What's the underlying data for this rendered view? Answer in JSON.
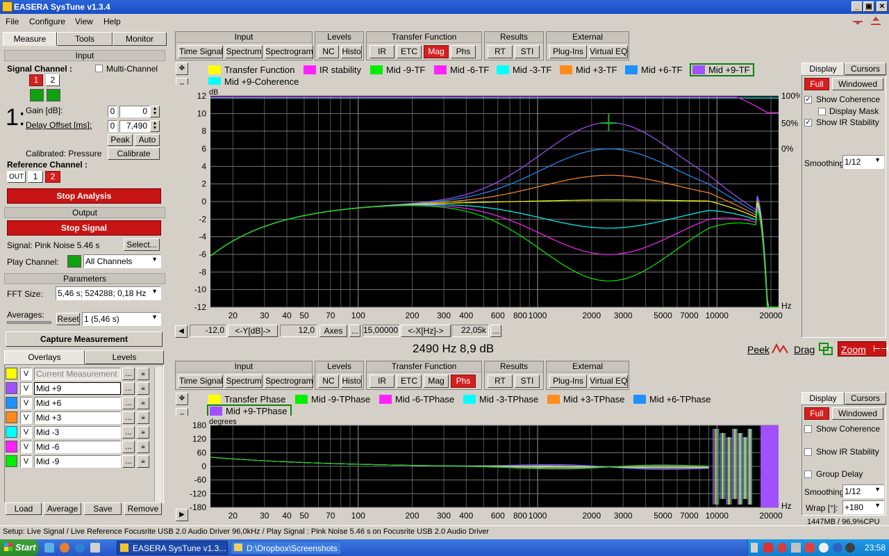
{
  "window": {
    "title": "EASERA SysTune v1.3.4",
    "min": "_",
    "max": "▣",
    "close": "✕"
  },
  "menu": [
    "File",
    "Configure",
    "View",
    "Help"
  ],
  "left": {
    "tabs": [
      "Measure",
      "Tools",
      "Monitor"
    ],
    "input": {
      "header": "Input",
      "signal_channel": "Signal Channel :",
      "multi_channel": "Multi-Channel",
      "ch1": "1",
      "ch2": "2",
      "big_index": "1:",
      "gain_label": "Gain [dB]:",
      "gain_check": "0",
      "gain_value": "0",
      "delay_label": "Delay Offset [ms]:",
      "delay_check": "0",
      "delay_value": "7,490",
      "peak": "Peak",
      "auto": "Auto",
      "calibrated": "Calibrated: Pressure",
      "calibrate": "Calibrate",
      "reference_channel": "Reference Channel :",
      "ref_out": "OUT",
      "ref_1": "1",
      "ref_2": "2"
    },
    "stop_analysis": "Stop Analysis",
    "output": {
      "header": "Output",
      "stop_signal": "Stop Signal",
      "signal_label": "Signal: Pink Noise  5.46 s",
      "select": "Select...",
      "play_channel": "Play Channel:",
      "play_value": "All Channels"
    },
    "parameters": {
      "header": "Parameters",
      "fft_label": "FFT Size:",
      "fft_value": "5,46 s; 524288; 0,18 Hz",
      "averages_label": "Averages:",
      "reset": "Reset",
      "avg_value": "1 (5,46 s)"
    },
    "capture": "Capture Measurement",
    "overlay_tabs": [
      "Overlays",
      "Levels"
    ],
    "overlays": [
      {
        "color": "#ffff00",
        "name": "Current Measurement",
        "v": "V"
      },
      {
        "color": "#a050ff",
        "name": "Mid +9",
        "v": "V"
      },
      {
        "color": "#1e90ff",
        "name": "Mid +6",
        "v": "V"
      },
      {
        "color": "#ff8c1a",
        "name": "Mid +3",
        "v": "V"
      },
      {
        "color": "#00ffff",
        "name": "Mid -3",
        "v": "V"
      },
      {
        "color": "#ff22ff",
        "name": "Mid -6",
        "v": "V"
      },
      {
        "color": "#00ee00",
        "name": "Mid -9",
        "v": "V"
      }
    ],
    "overlay_more": "...",
    "overlay_buttons": [
      "Load",
      "Average",
      "Save",
      "Remove"
    ]
  },
  "toolbar_groups": [
    {
      "title": "Input",
      "buttons": [
        "Time Signal",
        "Spectrum",
        "Spectrogram"
      ]
    },
    {
      "title": "Levels",
      "buttons": [
        "NC",
        "Histo"
      ]
    },
    {
      "title": "Transfer Function",
      "buttons": [
        "IR",
        "ETC",
        "Mag",
        "Phs"
      ]
    },
    {
      "title": "Results",
      "buttons": [
        "RT",
        "STI"
      ]
    },
    {
      "title": "External",
      "buttons": [
        "Plug-Ins",
        "Virtual EQ"
      ]
    }
  ],
  "top_plot": {
    "legend": [
      {
        "color": "#ffff00",
        "label": "Transfer Function"
      },
      {
        "color": "#ff22ff",
        "label": "IR stability"
      },
      {
        "color": "#00ee00",
        "label": "Mid -9-TF"
      },
      {
        "color": "#ff22ff",
        "label": "Mid -6-TF"
      },
      {
        "color": "#00ffff",
        "label": "Mid -3-TF"
      },
      {
        "color": "#ff8c1a",
        "label": "Mid +3-TF"
      },
      {
        "color": "#1e90ff",
        "label": "Mid +6-TF"
      },
      {
        "color": "#a050ff",
        "label": "Mid +9-TF"
      },
      {
        "color": "#00ffff",
        "label": "Mid +9-Coherence"
      }
    ],
    "y_unit": "dB",
    "x_unit": "Hz",
    "y_ticks": [
      "12",
      "10",
      "8",
      "6",
      "4",
      "2",
      "0",
      "-2",
      "-4",
      "-6",
      "-8",
      "-10",
      "-12"
    ],
    "right_ticks": [
      "100%",
      "50%",
      "0%"
    ],
    "x_ticks": [
      "20",
      "30",
      "40",
      "50",
      "70",
      "100",
      "200",
      "300",
      "400",
      "600",
      "800",
      "1000",
      "2000",
      "3000",
      "5000",
      "7000",
      "10000",
      "20000"
    ],
    "axis_bar": {
      "ymin": "-12,0",
      "ylab": "<-Y[dB]->",
      "ymax": "12,0",
      "axes": "Axes",
      "dots": "...",
      "xmin": "15,00000",
      "xlab": "<-X[Hz]->",
      "xmax": "22,05k"
    },
    "readout": "2490 Hz   8,9 dB",
    "peek": "Peek",
    "drag": "Drag",
    "zoom": "Zoom"
  },
  "top_side": {
    "tabs": [
      "Display",
      "Cursors"
    ],
    "full": "Full",
    "windowed": "Windowed",
    "show_coherence": "Show Coherence",
    "display_mask": "Display Mask",
    "show_ir_stability": "Show IR Stability",
    "smoothing_label": "Smoothing:",
    "smoothing_value": "1/12"
  },
  "bottom_plot": {
    "legend": [
      {
        "color": "#ffff00",
        "label": "Transfer Phase"
      },
      {
        "color": "#00ee00",
        "label": "Mid -9-TPhase"
      },
      {
        "color": "#ff22ff",
        "label": "Mid -6-TPhase"
      },
      {
        "color": "#00ffff",
        "label": "Mid -3-TPhase"
      },
      {
        "color": "#ff8c1a",
        "label": "Mid +3-TPhase"
      },
      {
        "color": "#1e90ff",
        "label": "Mid +6-TPhase"
      },
      {
        "color": "#a050ff",
        "label": "Mid +9-TPhase"
      }
    ],
    "y_unit": "degrees",
    "x_unit": "Hz",
    "y_ticks": [
      "180",
      "120",
      "60",
      "0",
      "-60",
      "-120",
      "-180"
    ],
    "x_ticks": [
      "20",
      "30",
      "40",
      "50",
      "70",
      "100",
      "200",
      "300",
      "400",
      "600",
      "800",
      "1000",
      "2000",
      "3000",
      "5000",
      "7000",
      "10000",
      "20000"
    ]
  },
  "bottom_side": {
    "tabs": [
      "Display",
      "Cursors"
    ],
    "full": "Full",
    "windowed": "Windowed",
    "show_coherence": "Show Coherence",
    "show_ir_stability": "Show IR Stability",
    "group_delay": "Group Delay",
    "smoothing_label": "Smoothing:",
    "smoothing_value": "1/12",
    "wrap_label": "Wrap [°]:",
    "wrap_value": "+180",
    "memory": "1447MB / 96,9%CPU"
  },
  "status": "Setup: Live Signal / Live Reference Focusrite USB 2.0 Audio Driver 96,0kHz / Play Signal : Pink Noise  5.46 s on Focusrite USB 2.0 Audio Driver",
  "taskbar": {
    "start": "Start",
    "items": [
      "EASERA SysTune v1.3...",
      "D:\\Dropbox\\Screenshots"
    ],
    "clock": "23:58"
  }
}
